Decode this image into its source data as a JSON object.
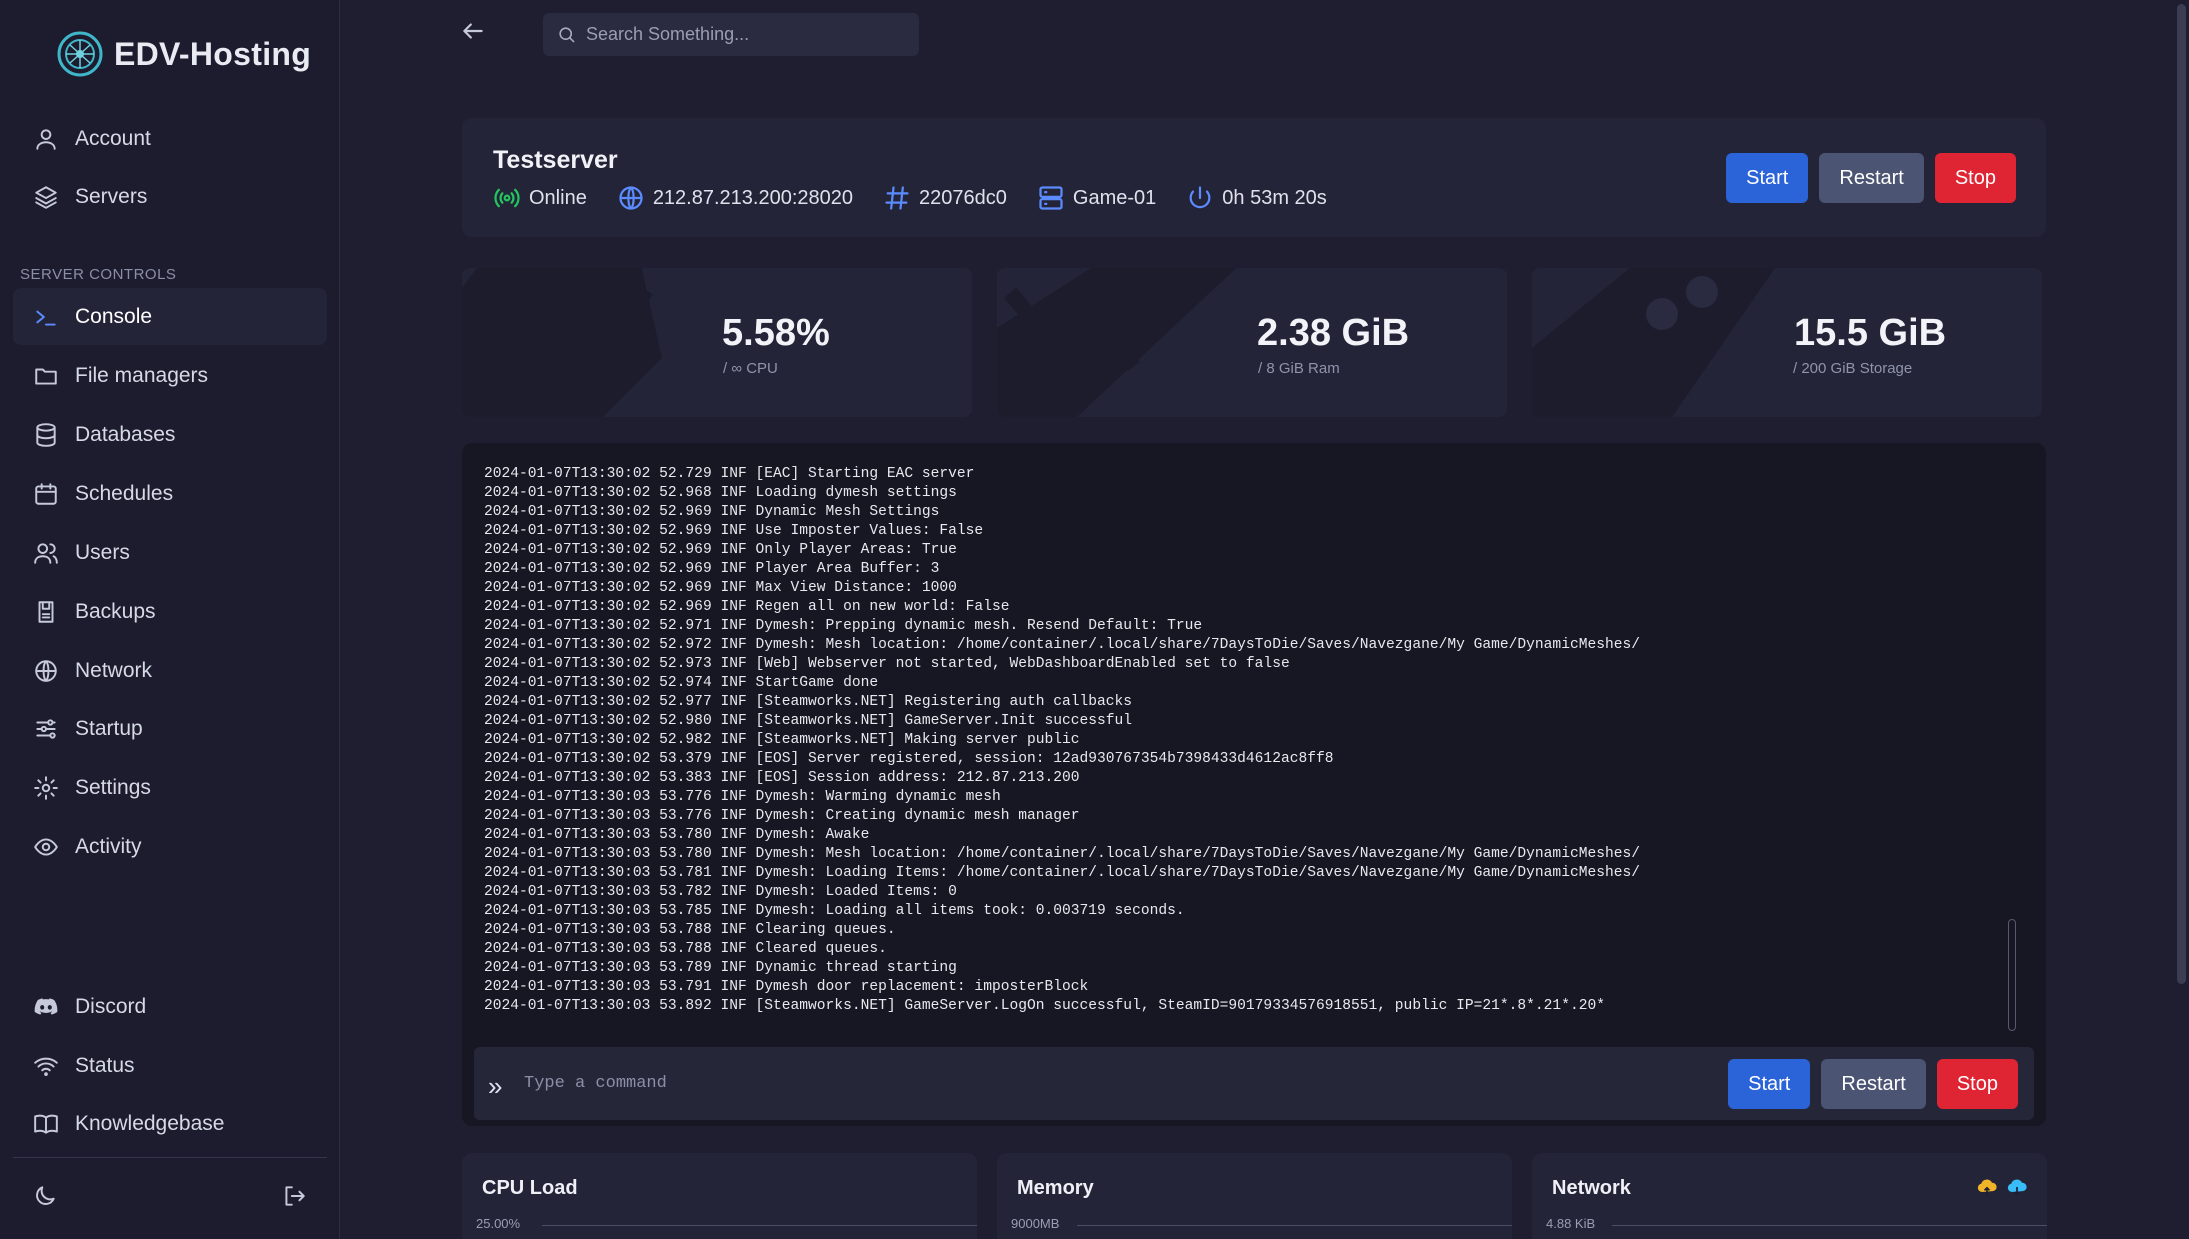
{
  "brand": {
    "name": "EDV-Hosting"
  },
  "sidebar": {
    "top_items": [
      {
        "label": "Account",
        "icon": "user-icon"
      },
      {
        "label": "Servers",
        "icon": "layers-icon"
      }
    ],
    "section_label": "SERVER CONTROLS",
    "server_items": [
      {
        "label": "Console",
        "icon": "terminal-icon",
        "active": true
      },
      {
        "label": "File managers",
        "icon": "folder-icon"
      },
      {
        "label": "Databases",
        "icon": "database-icon"
      },
      {
        "label": "Schedules",
        "icon": "calendar-icon"
      },
      {
        "label": "Users",
        "icon": "users-icon"
      },
      {
        "label": "Backups",
        "icon": "backup-icon"
      },
      {
        "label": "Network",
        "icon": "globe-icon"
      },
      {
        "label": "Startup",
        "icon": "sliders-icon"
      },
      {
        "label": "Settings",
        "icon": "gear-icon"
      },
      {
        "label": "Activity",
        "icon": "eye-icon"
      }
    ],
    "bottom_items": [
      {
        "label": "Discord",
        "icon": "discord-icon"
      },
      {
        "label": "Status",
        "icon": "wifi-icon"
      },
      {
        "label": "Knowledgebase",
        "icon": "book-icon"
      }
    ]
  },
  "search": {
    "placeholder": "Search Something..."
  },
  "server": {
    "name": "Testserver",
    "status": "Online",
    "address": "212.87.213.200:28020",
    "id": "22076dc0",
    "node": "Game-01",
    "uptime": "0h 53m 20s",
    "buttons": {
      "start": "Start",
      "restart": "Restart",
      "stop": "Stop"
    }
  },
  "stats": {
    "cpu": {
      "value": "5.58%",
      "sub": "/ ∞ CPU"
    },
    "ram": {
      "value": "2.38 GiB",
      "sub": "/ 8 GiB Ram"
    },
    "storage": {
      "value": "15.5 GiB",
      "sub": "/ 200 GiB Storage"
    }
  },
  "console": {
    "lines": [
      "2024-01-07T13:30:02 52.729 INF [EAC] Starting EAC server",
      "2024-01-07T13:30:02 52.968 INF Loading dymesh settings",
      "2024-01-07T13:30:02 52.969 INF Dynamic Mesh Settings",
      "2024-01-07T13:30:02 52.969 INF Use Imposter Values: False",
      "2024-01-07T13:30:02 52.969 INF Only Player Areas: True",
      "2024-01-07T13:30:02 52.969 INF Player Area Buffer: 3",
      "2024-01-07T13:30:02 52.969 INF Max View Distance: 1000",
      "2024-01-07T13:30:02 52.969 INF Regen all on new world: False",
      "2024-01-07T13:30:02 52.971 INF Dymesh: Prepping dynamic mesh. Resend Default: True",
      "2024-01-07T13:30:02 52.972 INF Dymesh: Mesh location: /home/container/.local/share/7DaysToDie/Saves/Navezgane/My Game/DynamicMeshes/",
      "2024-01-07T13:30:02 52.973 INF [Web] Webserver not started, WebDashboardEnabled set to false",
      "2024-01-07T13:30:02 52.974 INF StartGame done",
      "2024-01-07T13:30:02 52.977 INF [Steamworks.NET] Registering auth callbacks",
      "2024-01-07T13:30:02 52.980 INF [Steamworks.NET] GameServer.Init successful",
      "2024-01-07T13:30:02 52.982 INF [Steamworks.NET] Making server public",
      "2024-01-07T13:30:02 53.379 INF [EOS] Server registered, session: 12ad930767354b7398433d4612ac8ff8",
      "2024-01-07T13:30:02 53.383 INF [EOS] Session address: 212.87.213.200",
      "2024-01-07T13:30:03 53.776 INF Dymesh: Warming dynamic mesh",
      "2024-01-07T13:30:03 53.776 INF Dymesh: Creating dynamic mesh manager",
      "2024-01-07T13:30:03 53.780 INF Dymesh: Awake",
      "2024-01-07T13:30:03 53.780 INF Dymesh: Mesh location: /home/container/.local/share/7DaysToDie/Saves/Navezgane/My Game/DynamicMeshes/",
      "2024-01-07T13:30:03 53.781 INF Dymesh: Loading Items: /home/container/.local/share/7DaysToDie/Saves/Navezgane/My Game/DynamicMeshes/",
      "2024-01-07T13:30:03 53.782 INF Dymesh: Loaded Items: 0",
      "2024-01-07T13:30:03 53.785 INF Dymesh: Loading all items took: 0.003719 seconds.",
      "2024-01-07T13:30:03 53.788 INF Clearing queues.",
      "2024-01-07T13:30:03 53.788 INF Cleared queues.",
      "2024-01-07T13:30:03 53.789 INF Dynamic thread starting",
      "2024-01-07T13:30:03 53.791 INF Dymesh door replacement: imposterBlock",
      "2024-01-07T13:30:03 53.892 INF [Steamworks.NET] GameServer.LogOn successful, SteamID=90179334576918551, public IP=21*.8*.21*.20*"
    ],
    "command_placeholder": "Type a command",
    "buttons": {
      "start": "Start",
      "restart": "Restart",
      "stop": "Stop"
    }
  },
  "charts": {
    "cpu": {
      "title": "CPU Load",
      "axis_max": "25.00%"
    },
    "memory": {
      "title": "Memory",
      "axis_max": "9000MB"
    },
    "network": {
      "title": "Network",
      "axis_max": "4.88 KiB"
    }
  },
  "colors": {
    "accent": "#2b63d9",
    "stop": "#df2433",
    "restart": "#4b5473",
    "online": "#22c55e",
    "meta_icon": "#5b8cff"
  }
}
